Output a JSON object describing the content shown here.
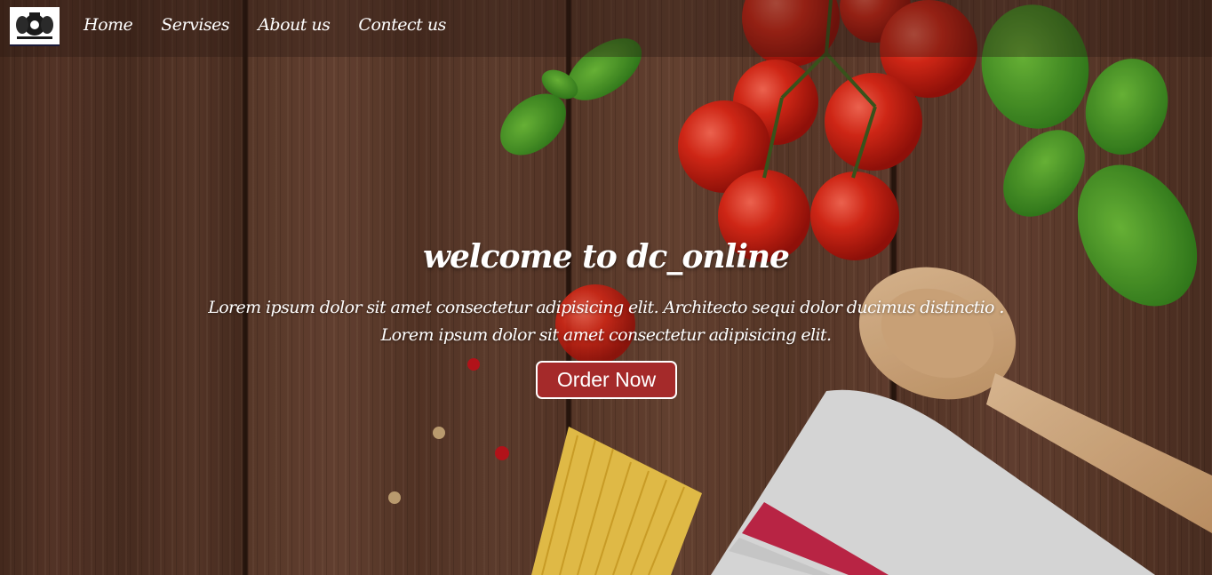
{
  "nav": {
    "logo_icon": "crest-logo-icon",
    "links": [
      {
        "label": "Home"
      },
      {
        "label": "Servises"
      },
      {
        "label": "About us"
      },
      {
        "label": "Contect us"
      }
    ]
  },
  "hero": {
    "title": "welcome to dc_online",
    "subtitle_line1": "Lorem ipsum dolor sit amet consectetur adipisicing elit. Architecto sequi dolor ducimus distinctio .",
    "subtitle_line2": "Lorem ipsum dolor sit amet consectetur adipisicing elit.",
    "cta_label": "Order Now"
  },
  "colors": {
    "cta_background": "#a52a2a",
    "text": "#ffffff"
  }
}
